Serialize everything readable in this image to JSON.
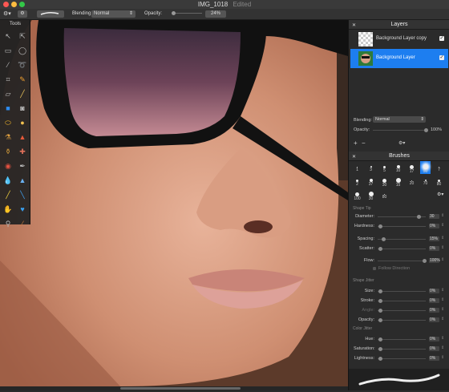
{
  "window": {
    "title": "IMG_1018",
    "state": "Edited"
  },
  "toolbar": {
    "blending_label": "Blending:",
    "blending_value": "Normal",
    "opacity_label": "Opacity:",
    "opacity_value": "24%"
  },
  "tools": {
    "title": "Tools"
  },
  "layers": {
    "title": "Layers",
    "items": [
      {
        "name": "Background Layer copy",
        "visible": true,
        "selected": false
      },
      {
        "name": "Background Layer",
        "visible": true,
        "selected": true
      }
    ],
    "blending_label": "Blending:",
    "blending_value": "Normal",
    "opacity_label": "Opacity:",
    "opacity_value": "100%",
    "add_label": "+",
    "remove_label": "−"
  },
  "brushes": {
    "title": "Brushes",
    "row1": [
      "1",
      "3",
      "5",
      "10",
      "17",
      "50",
      "7"
    ],
    "row2": [
      "2",
      "37",
      "30",
      "15",
      "20",
      "70",
      "80"
    ],
    "row3": [
      "100",
      "30",
      "80"
    ],
    "selected": "50",
    "shape_tip": {
      "title": "Shape Tip",
      "diameter": {
        "label": "Diameter:",
        "value": "30"
      },
      "hardness": {
        "label": "Hardness:",
        "value": "0%"
      },
      "spacing": {
        "label": "Spacing:",
        "value": "15%"
      },
      "scatter": {
        "label": "Scatter:",
        "value": "0%"
      },
      "flow": {
        "label": "Flow:",
        "value": "100%"
      },
      "follow": "Follow Direction"
    },
    "shape_jitter": {
      "title": "Shape Jitter",
      "size": {
        "label": "Size:",
        "value": "0%"
      },
      "stroke": {
        "label": "Stroke:",
        "value": "0%"
      },
      "angle": {
        "label": "Angle:",
        "value": "0%"
      },
      "opacity": {
        "label": "Opacity:",
        "value": "0%"
      }
    },
    "color_jitter": {
      "title": "Color Jitter",
      "hue": {
        "label": "Hue:",
        "value": "0%"
      },
      "saturation": {
        "label": "Saturation:",
        "value": "0%"
      },
      "lightness": {
        "label": "Lightness:",
        "value": "0%"
      }
    }
  },
  "colors": {
    "accent": "#1d7ef0",
    "panel": "#2b2b2b",
    "tools_bg": "#222222"
  }
}
